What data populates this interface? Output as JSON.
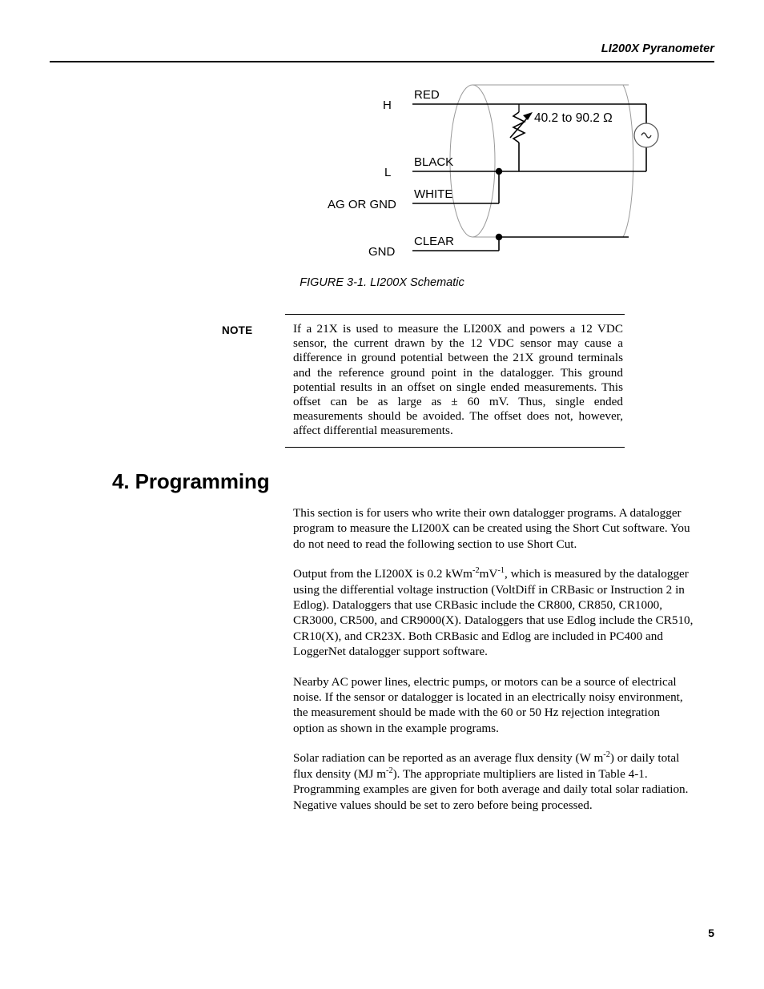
{
  "header": {
    "title": "LI200X Pyranometer"
  },
  "figure": {
    "caption": "FIGURE 3-1.  LI200X Schematic",
    "schematic": {
      "terminals": [
        {
          "name": "H",
          "label": "H"
        },
        {
          "name": "L",
          "label": "L"
        },
        {
          "name": "AG OR GND",
          "label": "AG OR GND"
        },
        {
          "name": "GND",
          "label": "GND"
        }
      ],
      "wires": [
        {
          "color": "RED",
          "label": "RED"
        },
        {
          "color": "BLACK",
          "label": "BLACK"
        },
        {
          "color": "WHITE",
          "label": "WHITE"
        },
        {
          "color": "CLEAR",
          "label": "CLEAR"
        }
      ],
      "resistor_value": "40.2 to 90.2 Ω",
      "source_symbol": "~"
    }
  },
  "note": {
    "label": "NOTE",
    "text": "If a 21X is used to measure the LI200X and powers a 12 VDC sensor, the current drawn by the 12 VDC sensor may cause a difference in ground potential between the 21X ground terminals and the reference ground point in the datalogger.  This ground potential results in an offset on single ended measurements.  This offset can be as large as ± 60 mV.  Thus, single ended measurements should be avoided.  The offset does not, however, affect differential measurements."
  },
  "section": {
    "heading": "4.  Programming",
    "paragraphs": {
      "p1": "This section is for users who write their own datalogger programs.  A datalogger program to measure the LI200X can be created using the Short Cut software.  You do not need to read the following section to use Short Cut.",
      "p2_a": "Output from the LI200X is 0.2 kWm",
      "p2_sup1": "-2",
      "p2_b": "mV",
      "p2_sup2": "-1",
      "p2_c": ", which is measured by the datalogger using the differential voltage instruction (VoltDiff in CRBasic or Instruction 2 in Edlog).  Dataloggers that use CRBasic include the CR800, CR850, CR1000, CR3000, CR500, and CR9000(X).  Dataloggers that use Edlog include the CR510, CR10(X), and CR23X.  Both CRBasic and Edlog are included in PC400 and LoggerNet datalogger support software.",
      "p3": "Nearby AC power lines, electric pumps, or motors can be a source of electrical noise.  If the sensor or datalogger is located in an electrically noisy environment, the measurement should be made with the 60 or 50 Hz rejection integration option as shown in the example programs.",
      "p4_a": "Solar radiation can be reported as an average flux density (W m",
      "p4_sup1": "-2",
      "p4_b": ") or daily total flux density (MJ m",
      "p4_sup2": "-2",
      "p4_c": ").  The appropriate multipliers are listed in Table 4-1.  Programming examples are given for both average and daily total solar radiation.  Negative values should be set to zero before being processed."
    }
  },
  "footer": {
    "page_number": "5"
  },
  "colors": {
    "ink": "#000000",
    "paper": "#ffffff",
    "cable_outline": "#9a9a9a"
  }
}
